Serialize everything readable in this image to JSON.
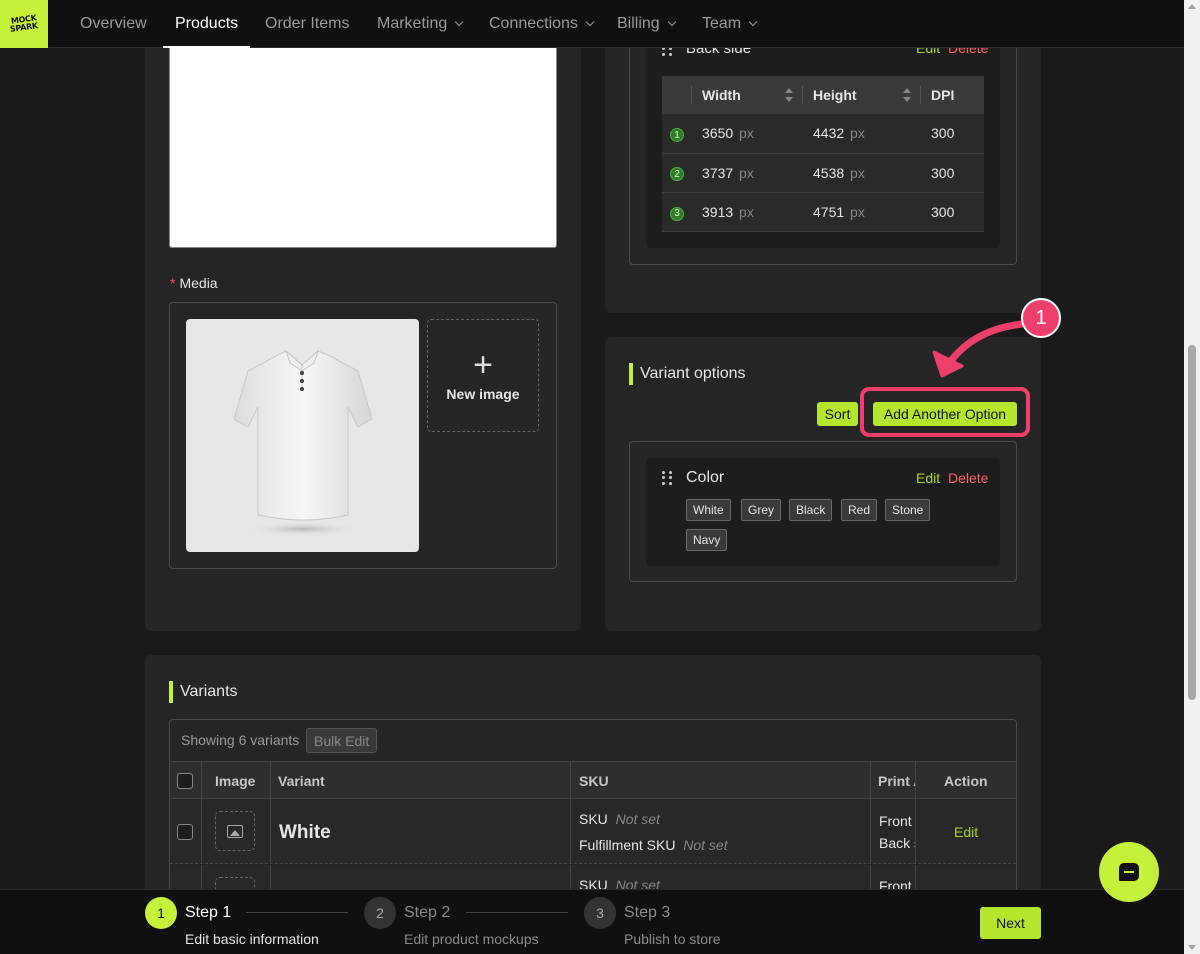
{
  "nav": {
    "logo_top": "MOCK",
    "logo_bottom": "SPARK",
    "items": [
      {
        "label": "Overview"
      },
      {
        "label": "Products"
      },
      {
        "label": "Order Items"
      },
      {
        "label": "Marketing"
      },
      {
        "label": "Connections"
      },
      {
        "label": "Billing"
      },
      {
        "label": "Team"
      }
    ],
    "active": "Products"
  },
  "media": {
    "label": "Media",
    "required_mark": "*",
    "new_image_label": "New image"
  },
  "print_area": {
    "title": "Back side",
    "edit_label": "Edit",
    "delete_label": "Delete",
    "columns": [
      "Width",
      "Height",
      "DPI"
    ],
    "unit": "px",
    "rows": [
      {
        "num": "1",
        "width": "3650",
        "height": "4432",
        "dpi": "300"
      },
      {
        "num": "2",
        "width": "3737",
        "height": "4538",
        "dpi": "300"
      },
      {
        "num": "3",
        "width": "3913",
        "height": "4751",
        "dpi": "300"
      }
    ]
  },
  "variant_options": {
    "title": "Variant options",
    "sort_label": "Sort",
    "add_label": "Add Another Option",
    "annotation_number": "1",
    "option": {
      "name": "Color",
      "edit_label": "Edit",
      "delete_label": "Delete",
      "values": [
        "White",
        "Grey",
        "Black",
        "Red",
        "Stone",
        "Navy"
      ]
    }
  },
  "variants": {
    "title": "Variants",
    "showing": "Showing 6 variants",
    "bulk_edit": "Bulk Edit",
    "columns": {
      "image": "Image",
      "variant": "Variant",
      "sku": "SKU",
      "print": "Print A",
      "action": "Action"
    },
    "rows": [
      {
        "name": "White",
        "sku_label": "SKU",
        "sku_value": "Not set",
        "fulfillment_label": "Fulfillment SKU",
        "fulfillment_value": "Not set",
        "print_front": "Front",
        "print_back": "Back s",
        "action": "Edit"
      },
      {
        "sku_label": "SKU",
        "sku_value": "Not set",
        "print_front": "Front"
      }
    ]
  },
  "steps": [
    {
      "num": "1",
      "title": "Step 1",
      "desc": "Edit basic information",
      "active": true
    },
    {
      "num": "2",
      "title": "Step 2",
      "desc": "Edit product mockups",
      "active": false
    },
    {
      "num": "3",
      "title": "Step 3",
      "desc": "Publish to store",
      "active": false
    }
  ],
  "next_label": "Next",
  "colors": {
    "accent": "#c5f13a",
    "highlight": "#ee3f6c",
    "delete": "#ff5e5e"
  }
}
